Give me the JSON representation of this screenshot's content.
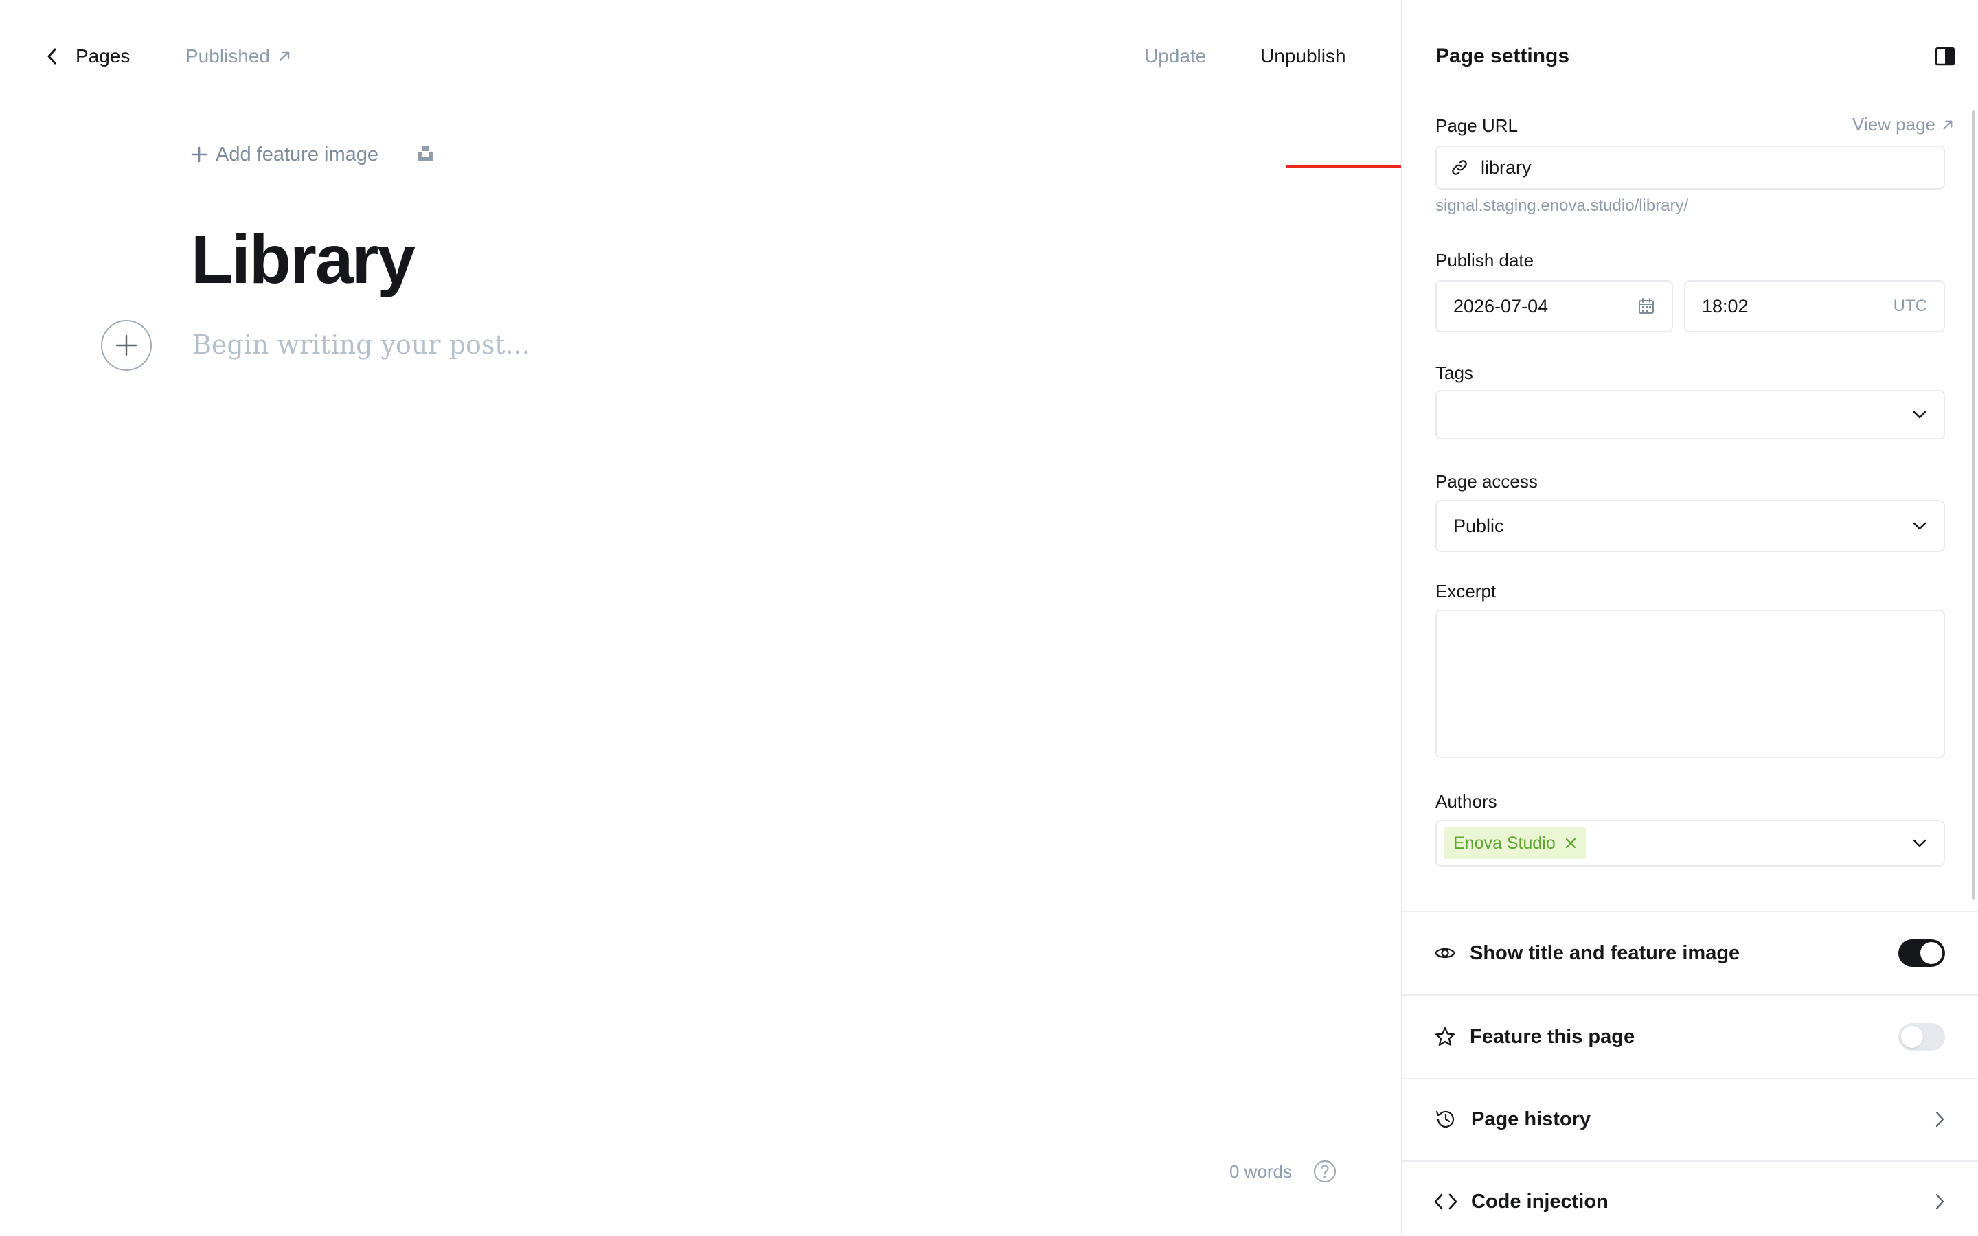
{
  "topbar": {
    "back_label": "Pages",
    "status_label": "Published",
    "update_label": "Update",
    "unpublish_label": "Unpublish"
  },
  "editor": {
    "add_feature_image_label": "Add feature image",
    "title": "Library",
    "body_placeholder": "Begin writing your post...",
    "word_count": "0 words"
  },
  "settings": {
    "title": "Page settings",
    "page_url": {
      "label": "Page URL",
      "view_page_label": "View page",
      "value": "library",
      "hint": "signal.staging.enova.studio/library/"
    },
    "publish_date": {
      "label": "Publish date",
      "date": "2026-07-04",
      "time": "18:02",
      "timezone": "UTC"
    },
    "tags": {
      "label": "Tags",
      "value": ""
    },
    "page_access": {
      "label": "Page access",
      "value": "Public"
    },
    "excerpt": {
      "label": "Excerpt",
      "value": ""
    },
    "authors": {
      "label": "Authors",
      "chips": [
        "Enova Studio"
      ]
    },
    "show_title_feature": {
      "label": "Show title and feature image",
      "enabled": true
    },
    "feature_page": {
      "label": "Feature this page",
      "enabled": false
    },
    "page_history": {
      "label": "Page history"
    },
    "code_injection": {
      "label": "Code injection"
    }
  },
  "colors": {
    "annotation_arrow": "#e8291c",
    "author_chip_bg": "#eaf6d4",
    "author_chip_text": "#5da72f",
    "muted_text": "#8e9cac"
  },
  "icons": {
    "back": "chevron-left-icon",
    "status": "arrow-up-right-icon",
    "add": "plus-icon",
    "unsplash": "unsplash-icon",
    "help": "question-circle-icon",
    "panel_toggle": "sidebar-toggle-icon",
    "link": "link-icon",
    "calendar": "calendar-icon",
    "select_arrow": "chevron-down-icon",
    "remove_chip": "close-icon",
    "show_title": "eye-icon",
    "feature": "star-icon",
    "history": "history-icon",
    "code": "code-icon",
    "row_arrow": "chevron-right-icon"
  }
}
